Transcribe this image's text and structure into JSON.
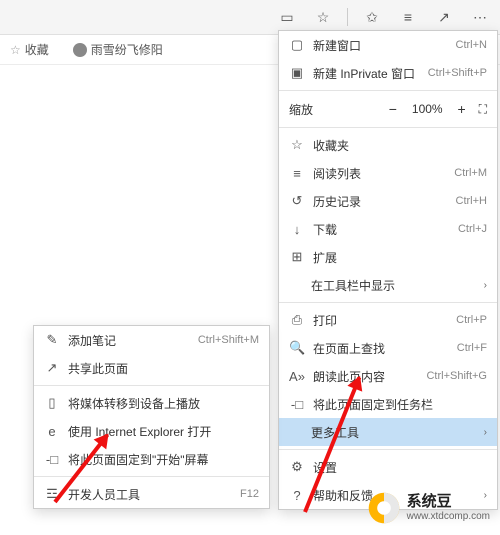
{
  "toolbar": {
    "icons": [
      "book",
      "star",
      "star-plus",
      "favorites",
      "share",
      "more"
    ]
  },
  "bookmarks": {
    "favorites_label": "收藏",
    "user_label": "雨雪纷飞修阳"
  },
  "menu": {
    "new_window": {
      "label": "新建窗口",
      "shortcut": "Ctrl+N"
    },
    "new_inprivate": {
      "label": "新建 InPrivate 窗口",
      "shortcut": "Ctrl+Shift+P"
    },
    "zoom": {
      "label": "缩放",
      "value": "100%"
    },
    "favorites": {
      "label": "收藏夹"
    },
    "reading_list": {
      "label": "阅读列表",
      "shortcut": "Ctrl+M"
    },
    "history": {
      "label": "历史记录",
      "shortcut": "Ctrl+H"
    },
    "downloads": {
      "label": "下载",
      "shortcut": "Ctrl+J"
    },
    "extensions": {
      "label": "扩展"
    },
    "show_in_toolbar": {
      "label": "在工具栏中显示"
    },
    "print": {
      "label": "打印",
      "shortcut": "Ctrl+P"
    },
    "find": {
      "label": "在页面上查找",
      "shortcut": "Ctrl+F"
    },
    "read_aloud": {
      "label": "朗读此页内容",
      "shortcut": "Ctrl+Shift+G"
    },
    "pin_taskbar": {
      "label": "将此页面固定到任务栏"
    },
    "more_tools": {
      "label": "更多工具"
    },
    "settings": {
      "label": "设置"
    },
    "help": {
      "label": "帮助和反馈"
    }
  },
  "submenu": {
    "add_notes": {
      "label": "添加笔记",
      "shortcut": "Ctrl+Shift+M"
    },
    "share": {
      "label": "共享此页面"
    },
    "cast": {
      "label": "将媒体转移到设备上播放"
    },
    "open_ie": {
      "label": "使用 Internet Explorer 打开"
    },
    "pin_start": {
      "label": "将此页面固定到\"开始\"屏幕"
    },
    "dev_tools": {
      "label": "开发人员工具",
      "shortcut": "F12"
    }
  },
  "watermark": {
    "title": "系统豆",
    "url": "www.xtdcomp.com"
  }
}
